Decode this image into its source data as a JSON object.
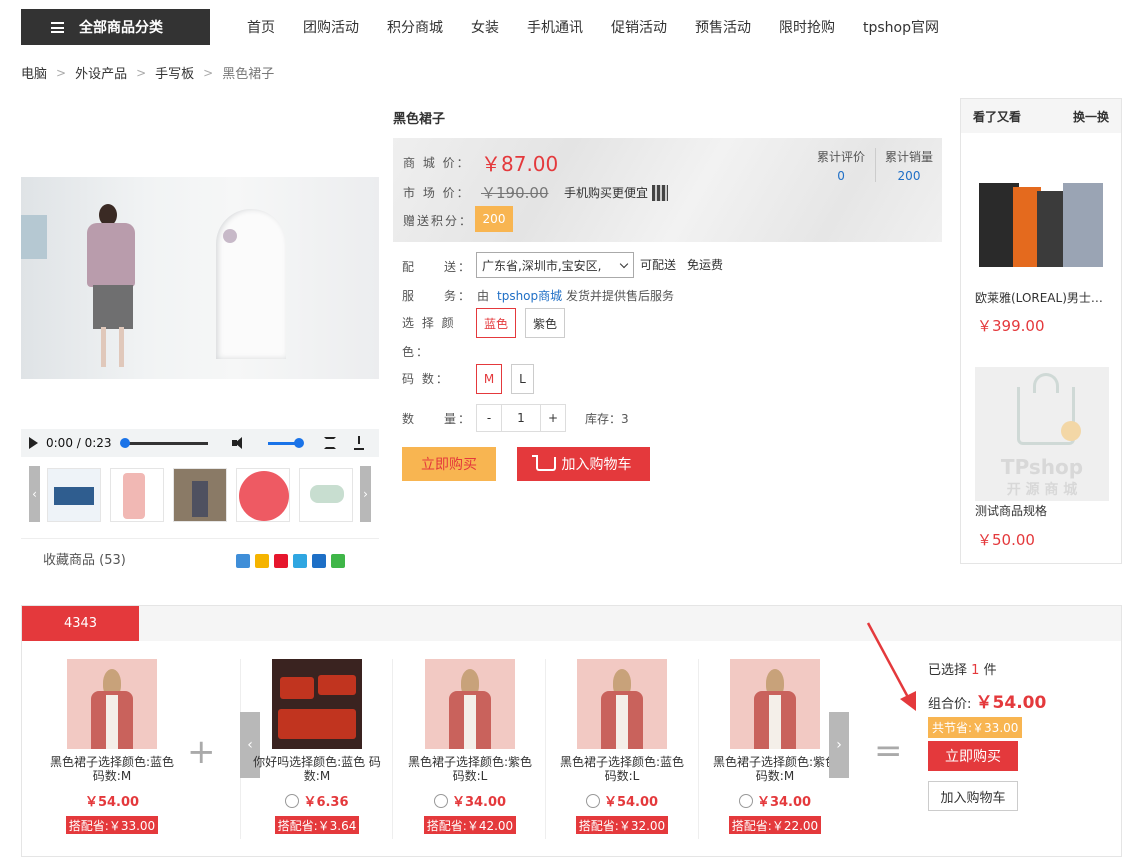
{
  "header": {
    "category_label": "全部商品分类",
    "nav": [
      "首页",
      "团购活动",
      "积分商城",
      "女装",
      "手机通讯",
      "促销活动",
      "预售活动",
      "限时抢购",
      "tpshop官网"
    ]
  },
  "breadcrumb": [
    "电脑",
    "外设产品",
    "手写板",
    "黑色裙子"
  ],
  "gallery": {
    "video_time": "0:00 / 0:23",
    "video_progress": 0,
    "volume_level": 1,
    "favorites": "收藏商品 (53)"
  },
  "product": {
    "title": "黑色裙子",
    "mall_price_label": "商 城 价：",
    "mall_price": "￥87.00",
    "market_price_label": "市 场 价：",
    "market_price": "￥190.00",
    "mobile_buy": "手机购买更便宜",
    "points_label": "赠送积分：",
    "points": "200",
    "reviews_label": "累计评价",
    "reviews": "0",
    "sales_label": "累计销量",
    "sales": "200",
    "delivery_label": "配　　送：",
    "delivery_region": "广东省,深圳市,宝安区,",
    "deliverable": "可配送",
    "free_shipping": "免运费",
    "service_label": "服　　务：",
    "service_prefix": "由",
    "service_shop": "tpshop商城",
    "service_suffix": "发货并提供售后服务",
    "color_label_1": "选 择 颜",
    "color_label_2": "色：",
    "colors": [
      "蓝色",
      "紫色"
    ],
    "size_label": "码 数：",
    "sizes": [
      "M",
      "L"
    ],
    "qty_label": "数　　量：",
    "qty_minus": "-",
    "qty_value": "1",
    "qty_plus": "+",
    "stock": "库存：3",
    "buy_now": "立即购买",
    "add_cart": "加入购物车"
  },
  "side": {
    "title": "看了又看",
    "refresh": "换一换",
    "items": [
      {
        "name": "欧莱雅(LOREAL)男士8...",
        "price": "￥399.00"
      },
      {
        "name": "测试商品规格",
        "price": "￥50.00",
        "watermark_1": "TPshop",
        "watermark_2": "开 源 商 城"
      }
    ]
  },
  "combo": {
    "tab": "4343",
    "items": [
      {
        "name": "黑色裙子选择颜色:蓝色 码数:M",
        "price": "￥54.00",
        "save": "搭配省:￥33.00"
      },
      {
        "name": "你好吗选择颜色:蓝色 码数:M",
        "price": "￥6.36",
        "save": "搭配省:￥3.64"
      },
      {
        "name": "黑色裙子选择颜色:紫色 码数:L",
        "price": "￥34.00",
        "save": "搭配省:￥42.00"
      },
      {
        "name": "黑色裙子选择颜色:蓝色 码数:L",
        "price": "￥54.00",
        "save": "搭配省:￥32.00"
      },
      {
        "name": "黑色裙子选择颜色:紫色 码数:M",
        "price": "￥34.00",
        "save": "搭配省:￥22.00"
      }
    ],
    "selected_prefix": "已选择",
    "selected_count": "1",
    "selected_suffix": "件",
    "total_label": "组合价:",
    "total_price": "￥54.00",
    "saved": "共节省:￥33.00",
    "buy_now": "立即购买",
    "add_cart": "加入购物车"
  },
  "colors": {
    "accent": "#e4393c",
    "orange": "#f8b551",
    "link": "#1f6fc6"
  }
}
